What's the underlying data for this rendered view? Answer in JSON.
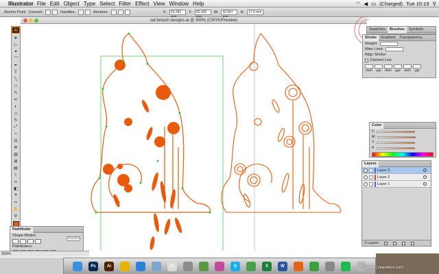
{
  "menubar": {
    "app_name": "Illustrator",
    "items": [
      "File",
      "Edit",
      "Object",
      "Type",
      "Select",
      "Filter",
      "Effect",
      "View",
      "Window",
      "Help"
    ],
    "battery": "(Charged)",
    "clock": "Tue 15:19"
  },
  "controlbar": {
    "tool_label": "Anchor Point",
    "convert_label": "Convert:",
    "handles_label": "Handles:",
    "anchors_label": "Anchors:",
    "x_value": "53.282 mm",
    "y_value": "50.355 mm",
    "w_value": "32.667 mm",
    "h_value": "17.9 mm"
  },
  "document": {
    "title": "cat brooch designs.ai @ 300% (CMYK/Preview)"
  },
  "status": {
    "zoom": "300%"
  },
  "toolpanel": {
    "logo": "Ai",
    "fill_color": "#e95b0c"
  },
  "panels": {
    "swatches_tabs": [
      "Swatches",
      "Brushes",
      "Symbols"
    ],
    "stroke_tabs": [
      "Stroke",
      "Gradient",
      "Transparency"
    ],
    "stroke_weight_label": "Weight:",
    "stroke_miter_label": "Miter Limit:",
    "stroke_align_label": "Align Stroke:",
    "stroke_dashed_label": "Dashed Line",
    "dash_labels": [
      "dash",
      "gap",
      "dash",
      "gap",
      "dash",
      "gap"
    ],
    "color_tab": "Color",
    "color_channels": [
      "C",
      "M",
      "Y",
      "K"
    ],
    "layers_tab": "Layers",
    "layers": [
      {
        "name": "Layer 3",
        "color": "#3b6df0",
        "active": true
      },
      {
        "name": "Layer 2",
        "color": "#e53935",
        "active": false
      },
      {
        "name": "Layer 1",
        "color": "#3b6df0",
        "active": false
      }
    ],
    "layers_count": "3 Layers",
    "pathfinder_tab": "Pathfinder",
    "shape_modes_label": "Shape Modes:",
    "pathfinders_label": "Pathfinders:",
    "expand_label": "Expand"
  },
  "dock": {
    "apps": [
      {
        "name": "finder-icon",
        "label": "",
        "color": "#3a8fe0"
      },
      {
        "name": "photoshop-icon",
        "label": "Ps",
        "color": "#0b2b55"
      },
      {
        "name": "illustrator-icon",
        "label": "Ai",
        "color": "#4a2200"
      },
      {
        "name": "chrome-icon",
        "label": "",
        "color": "#e8b400"
      },
      {
        "name": "safari-icon",
        "label": "",
        "color": "#2e7fd6"
      },
      {
        "name": "mail-icon",
        "label": "",
        "color": "#7aa6cf"
      },
      {
        "name": "calendar-icon",
        "label": "23",
        "color": "#d9d9d9"
      },
      {
        "name": "preview-icon",
        "label": "",
        "color": "#8c8c8c"
      },
      {
        "name": "photos-icon",
        "label": "",
        "color": "#5b9a45"
      },
      {
        "name": "itunes-icon",
        "label": "",
        "color": "#c44aa0"
      },
      {
        "name": "skype-icon",
        "label": "S",
        "color": "#1faae8"
      },
      {
        "name": "maps-icon",
        "label": "",
        "color": "#4aa04a"
      },
      {
        "name": "excel-icon",
        "label": "X",
        "color": "#1e7d3a"
      },
      {
        "name": "word-icon",
        "label": "W",
        "color": "#2a5699"
      },
      {
        "name": "firefox-icon",
        "label": "",
        "color": "#e0641a"
      },
      {
        "name": "facetime-icon",
        "label": "",
        "color": "#3aa03a"
      },
      {
        "name": "settings-icon",
        "label": "",
        "color": "#888888"
      },
      {
        "name": "spotify-icon",
        "label": "",
        "color": "#1db954"
      },
      {
        "name": "trash-icon",
        "label": "",
        "color": "#b8b8b8"
      }
    ]
  },
  "watermark": {
    "left": "Castro",
    "right": "seaotters.com"
  },
  "colors": {
    "artwork_stroke": "#e95b0c",
    "selection": "#2fbf3a"
  }
}
